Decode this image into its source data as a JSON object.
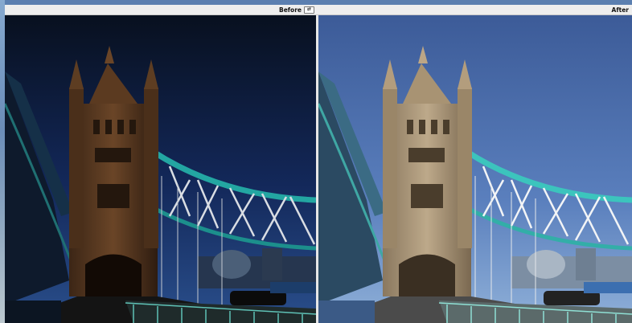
{
  "compare": {
    "before_label": "Before",
    "after_label": "After",
    "swap_icon": "swap-arrows-icon",
    "swap_glyph": "⇄"
  },
  "colors": {
    "before_sky_top": "#0a1228",
    "before_sky_bottom": "#1c3a72",
    "after_sky_top": "#3f5f9c",
    "after_sky_bottom": "#6f93c8",
    "bridge_cable": "#2bb5b0",
    "tower_stone_before": "#4a3220",
    "tower_stone_after": "#9c8b72"
  }
}
